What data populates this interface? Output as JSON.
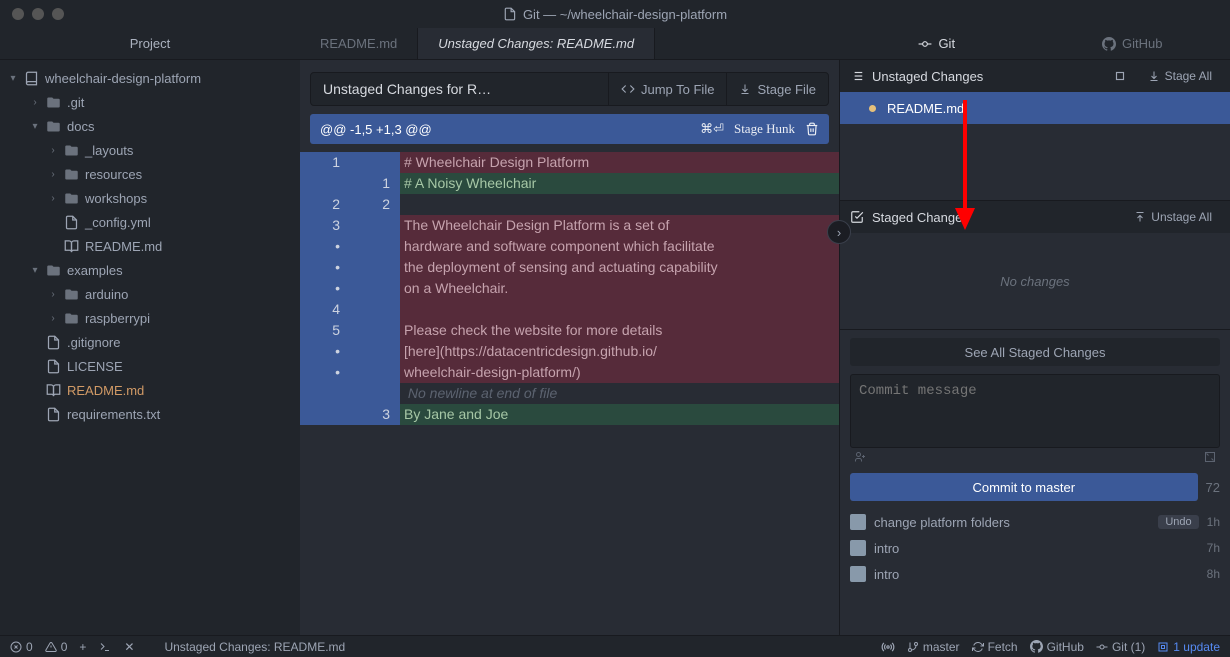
{
  "window": {
    "title": "Git — ~/wheelchair-design-platform"
  },
  "project": {
    "panel_title": "Project",
    "root": "wheelchair-design-platform",
    "tree": [
      {
        "label": ".git",
        "type": "folder",
        "expanded": false,
        "depth": 1
      },
      {
        "label": "docs",
        "type": "folder",
        "expanded": true,
        "depth": 1
      },
      {
        "label": "_layouts",
        "type": "folder",
        "expanded": false,
        "depth": 2
      },
      {
        "label": "resources",
        "type": "folder",
        "expanded": false,
        "depth": 2
      },
      {
        "label": "workshops",
        "type": "folder",
        "expanded": false,
        "depth": 2
      },
      {
        "label": "_config.yml",
        "type": "file",
        "depth": 2
      },
      {
        "label": "README.md",
        "type": "book",
        "depth": 2
      },
      {
        "label": "examples",
        "type": "folder",
        "expanded": true,
        "depth": 1
      },
      {
        "label": "arduino",
        "type": "folder",
        "expanded": false,
        "depth": 2
      },
      {
        "label": "raspberrypi",
        "type": "folder",
        "expanded": false,
        "depth": 2
      },
      {
        "label": ".gitignore",
        "type": "file",
        "depth": 1
      },
      {
        "label": "LICENSE",
        "type": "file",
        "depth": 1
      },
      {
        "label": "README.md",
        "type": "book",
        "depth": 1,
        "modified": true
      },
      {
        "label": "requirements.txt",
        "type": "file",
        "depth": 1
      }
    ]
  },
  "editor_tabs": {
    "items": [
      {
        "label": "README.md",
        "active": false
      },
      {
        "label": "Unstaged Changes: README.md",
        "active": true
      }
    ]
  },
  "git_tabs": {
    "git": "Git",
    "github": "GitHub"
  },
  "diff": {
    "header": "Unstaged Changes for R…",
    "jump": "Jump To File",
    "stage_file": "Stage File",
    "hunk_range": "@@ -1,5 +1,3 @@",
    "keys": "⌘⏎",
    "stage_hunk": "Stage Hunk",
    "lines": [
      {
        "old": "1",
        "new": "",
        "kind": "del",
        "text": "# Wheelchair Design Platform"
      },
      {
        "old": "",
        "new": "1",
        "kind": "add",
        "text": "# A Noisy Wheelchair"
      },
      {
        "old": "2",
        "new": "2",
        "kind": "ctx",
        "text": ""
      },
      {
        "old": "3",
        "new": "",
        "kind": "del",
        "text": "The Wheelchair Design Platform is a set of"
      },
      {
        "old": "•",
        "new": "",
        "kind": "del",
        "text": "hardware and software component which facilitate"
      },
      {
        "old": "•",
        "new": "",
        "kind": "del",
        "text": "the deployment of sensing and actuating capability"
      },
      {
        "old": "•",
        "new": "",
        "kind": "del",
        "text": "on a Wheelchair."
      },
      {
        "old": "4",
        "new": "",
        "kind": "del",
        "text": ""
      },
      {
        "old": "5",
        "new": "",
        "kind": "del",
        "text": "Please check the website for more details"
      },
      {
        "old": "•",
        "new": "",
        "kind": "del",
        "text": "[here](https://datacentricdesign.github.io/"
      },
      {
        "old": "•",
        "new": "",
        "kind": "del",
        "text": "wheelchair-design-platform/)"
      },
      {
        "old": "",
        "new": "",
        "kind": "meta",
        "text": " No newline at end of file"
      },
      {
        "old": "",
        "new": "3",
        "kind": "add",
        "text": "By Jane and Joe"
      }
    ]
  },
  "git_panel": {
    "unstaged_title": "Unstaged Changes",
    "stage_all": "Stage All",
    "unstaged_files": [
      "README.md"
    ],
    "staged_title": "Staged Changes",
    "unstage_all": "Unstage All",
    "no_changes": "No changes",
    "see_all": "See All Staged Changes",
    "commit_placeholder": "Commit message",
    "commit_btn": "Commit to master",
    "char_count": "72",
    "history": [
      {
        "msg": "change platform folders",
        "undo": "Undo",
        "time": "1h"
      },
      {
        "msg": "intro",
        "time": "7h"
      },
      {
        "msg": "intro",
        "time": "8h"
      }
    ]
  },
  "status": {
    "err": "0",
    "warn": "0",
    "path": "Unstaged Changes: README.md",
    "branch": "master",
    "fetch": "Fetch",
    "github": "GitHub",
    "git_count": "Git (1)",
    "updates": "1 update"
  }
}
